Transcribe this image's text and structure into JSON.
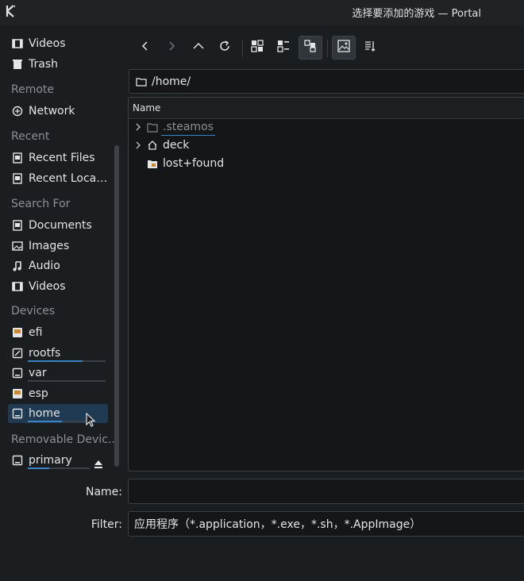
{
  "window": {
    "title": "选择要添加的游戏 — Portal"
  },
  "sidebar": {
    "top_items": [
      {
        "label": "Videos",
        "icon": "video-icon"
      },
      {
        "label": "Trash",
        "icon": "trash-icon"
      }
    ],
    "sections": {
      "remote": "Remote",
      "recent": "Recent",
      "search_for": "Search For",
      "devices": "Devices",
      "removable": "Removable Devic..."
    },
    "remote_items": [
      {
        "label": "Network",
        "icon": "network-icon"
      }
    ],
    "recent_items": [
      {
        "label": "Recent Files",
        "icon": "document-icon"
      },
      {
        "label": "Recent Locat...",
        "icon": "document-icon"
      }
    ],
    "search_items": [
      {
        "label": "Documents",
        "icon": "document-icon"
      },
      {
        "label": "Images",
        "icon": "image-icon"
      },
      {
        "label": "Audio",
        "icon": "music-note-icon"
      },
      {
        "label": "Videos",
        "icon": "video-icon"
      }
    ],
    "device_items": [
      {
        "label": "efi",
        "icon": "drive-icon",
        "usage": null
      },
      {
        "label": "rootfs",
        "icon": "drive-icon",
        "usage": 0.7
      },
      {
        "label": "var",
        "icon": "drive-icon",
        "usage": 0.98
      },
      {
        "label": "esp",
        "icon": "drive-icon",
        "usage": null
      },
      {
        "label": "home",
        "icon": "drive-icon",
        "usage": 0.55,
        "selected": true
      }
    ],
    "removable_items": [
      {
        "label": "primary",
        "icon": "drive-icon",
        "usage": 0.35
      }
    ]
  },
  "toolbar": {
    "buttons": [
      "back",
      "forward",
      "up",
      "reload",
      "icons-view",
      "compact-view",
      "detailed-tree-view",
      "preview",
      "sort"
    ]
  },
  "path": {
    "value": "/home/"
  },
  "file_view": {
    "column_header": "Name",
    "rows": [
      {
        "label": ".steamos",
        "icon": "folder-icon",
        "expandable": true,
        "hidden": true
      },
      {
        "label": "deck",
        "icon": "home-folder-icon",
        "expandable": true,
        "hidden": false
      },
      {
        "label": "lost+found",
        "icon": "locked-folder-icon",
        "expandable": false,
        "hidden": false
      }
    ]
  },
  "name_field": {
    "label": "Name:",
    "value": "",
    "placeholder": ""
  },
  "filter_field": {
    "label": "Filter:",
    "value": "应用程序（*.application，*.exe，*.sh，*.AppImage）"
  },
  "colors": {
    "background": "#1b1e20",
    "field_bg": "#141618",
    "accent": "#3b84c4",
    "selection": "#1f3a52"
  }
}
